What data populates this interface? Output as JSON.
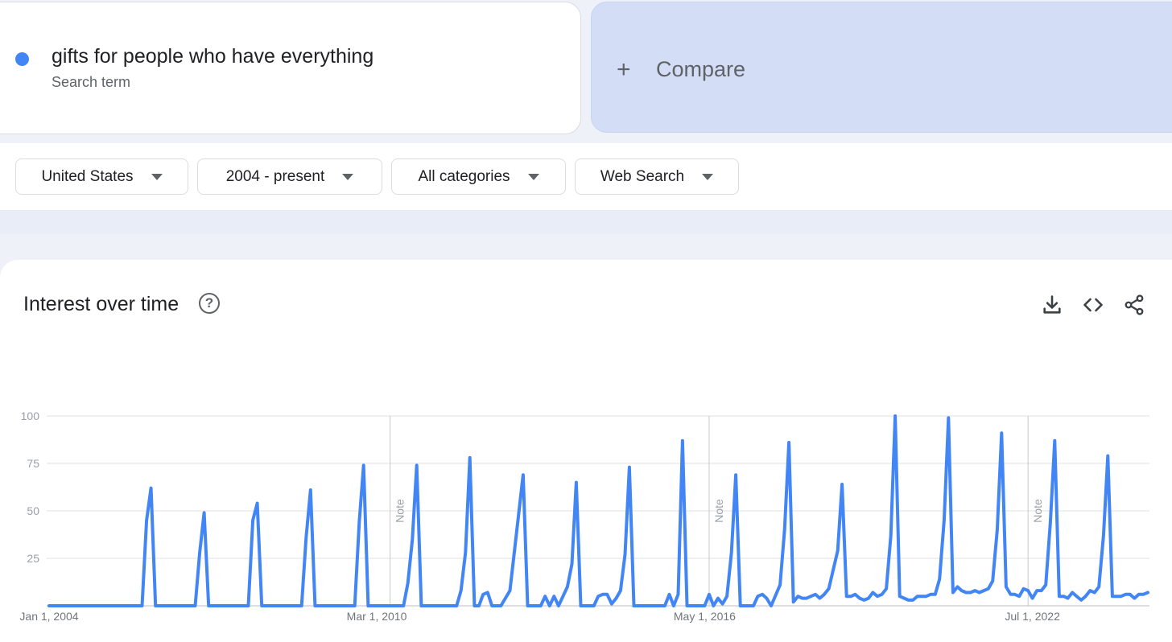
{
  "search_term": {
    "name": "gifts for people who have everything",
    "subtitle": "Search term",
    "color": "#4285f4"
  },
  "compare": {
    "label": "Compare",
    "icon": "plus-icon"
  },
  "filters": [
    {
      "label": "United States",
      "icon": "caret-down-icon"
    },
    {
      "label": "2004 - present",
      "icon": "caret-down-icon"
    },
    {
      "label": "All categories",
      "icon": "caret-down-icon"
    },
    {
      "label": "Web Search",
      "icon": "caret-down-icon"
    }
  ],
  "panel": {
    "title": "Interest over time",
    "help_icon": "question-circle-icon",
    "actions": [
      "download-icon",
      "embed-code-icon",
      "share-icon"
    ]
  },
  "chart_data": {
    "type": "line",
    "title": "",
    "xlabel": "",
    "ylabel": "",
    "ylim": [
      0,
      100
    ],
    "y_ticks": [
      "100",
      "75",
      "50",
      "25"
    ],
    "x_ticks": [
      {
        "date": "2004-01-01",
        "label": "Jan 1, 2004"
      },
      {
        "date": "2010-03-01",
        "label": "Mar 1, 2010"
      },
      {
        "date": "2016-05-01",
        "label": "May 1, 2016"
      },
      {
        "date": "2022-07-01",
        "label": "Jul 1, 2022"
      }
    ],
    "notes": [
      {
        "date": "2010-06-01",
        "label": "Note"
      },
      {
        "date": "2016-06-01",
        "label": "Note"
      },
      {
        "date": "2022-06-01",
        "label": "Note"
      }
    ],
    "grid": true,
    "series": [
      {
        "color": "#4285f4",
        "points": [
          [
            "2004-01-01",
            0
          ],
          [
            "2004-06-01",
            0
          ],
          [
            "2004-12-01",
            0
          ],
          [
            "2005-06-01",
            0
          ],
          [
            "2005-10-01",
            0
          ],
          [
            "2005-11-01",
            45
          ],
          [
            "2005-12-01",
            62
          ],
          [
            "2006-01-01",
            0
          ],
          [
            "2006-10-01",
            0
          ],
          [
            "2006-11-01",
            28
          ],
          [
            "2006-12-01",
            49
          ],
          [
            "2007-01-01",
            0
          ],
          [
            "2007-10-01",
            0
          ],
          [
            "2007-11-01",
            45
          ],
          [
            "2007-12-01",
            54
          ],
          [
            "2008-01-01",
            0
          ],
          [
            "2008-10-01",
            0
          ],
          [
            "2008-11-01",
            36
          ],
          [
            "2008-12-01",
            61
          ],
          [
            "2009-01-01",
            0
          ],
          [
            "2009-10-01",
            0
          ],
          [
            "2009-11-01",
            44
          ],
          [
            "2009-12-01",
            74
          ],
          [
            "2010-01-01",
            0
          ],
          [
            "2010-09-01",
            0
          ],
          [
            "2010-10-01",
            12
          ],
          [
            "2010-11-01",
            35
          ],
          [
            "2010-12-01",
            74
          ],
          [
            "2011-01-01",
            0
          ],
          [
            "2011-09-01",
            0
          ],
          [
            "2011-10-01",
            8
          ],
          [
            "2011-11-01",
            28
          ],
          [
            "2011-12-01",
            78
          ],
          [
            "2012-01-01",
            0
          ],
          [
            "2012-02-01",
            0
          ],
          [
            "2012-03-01",
            6
          ],
          [
            "2012-04-01",
            7
          ],
          [
            "2012-05-01",
            0
          ],
          [
            "2012-07-01",
            0
          ],
          [
            "2012-09-01",
            8
          ],
          [
            "2012-10-01",
            28
          ],
          [
            "2012-12-01",
            69
          ],
          [
            "2013-01-01",
            0
          ],
          [
            "2013-04-01",
            0
          ],
          [
            "2013-05-01",
            5
          ],
          [
            "2013-06-01",
            0
          ],
          [
            "2013-07-01",
            5
          ],
          [
            "2013-08-01",
            0
          ],
          [
            "2013-10-01",
            10
          ],
          [
            "2013-11-01",
            22
          ],
          [
            "2013-12-01",
            65
          ],
          [
            "2014-01-01",
            0
          ],
          [
            "2014-04-01",
            0
          ],
          [
            "2014-05-01",
            5
          ],
          [
            "2014-06-01",
            6
          ],
          [
            "2014-07-01",
            6
          ],
          [
            "2014-08-01",
            1
          ],
          [
            "2014-09-01",
            4
          ],
          [
            "2014-10-01",
            8
          ],
          [
            "2014-11-01",
            27
          ],
          [
            "2014-12-01",
            73
          ],
          [
            "2015-01-01",
            0
          ],
          [
            "2015-08-01",
            0
          ],
          [
            "2015-09-01",
            6
          ],
          [
            "2015-10-01",
            0
          ],
          [
            "2015-11-01",
            6
          ],
          [
            "2015-12-01",
            87
          ],
          [
            "2016-01-01",
            0
          ],
          [
            "2016-05-01",
            0
          ],
          [
            "2016-06-01",
            6
          ],
          [
            "2016-07-01",
            0
          ],
          [
            "2016-08-01",
            4
          ],
          [
            "2016-09-01",
            1
          ],
          [
            "2016-10-01",
            5
          ],
          [
            "2016-11-01",
            28
          ],
          [
            "2016-12-01",
            69
          ],
          [
            "2017-01-01",
            0
          ],
          [
            "2017-04-01",
            0
          ],
          [
            "2017-05-01",
            5
          ],
          [
            "2017-06-01",
            6
          ],
          [
            "2017-07-01",
            4
          ],
          [
            "2017-08-01",
            0
          ],
          [
            "2017-10-01",
            11
          ],
          [
            "2017-11-01",
            40
          ],
          [
            "2017-12-01",
            86
          ],
          [
            "2018-01-01",
            2
          ],
          [
            "2018-02-01",
            5
          ],
          [
            "2018-03-01",
            4
          ],
          [
            "2018-04-01",
            4
          ],
          [
            "2018-05-01",
            5
          ],
          [
            "2018-06-01",
            6
          ],
          [
            "2018-07-01",
            4
          ],
          [
            "2018-08-01",
            6
          ],
          [
            "2018-09-01",
            9
          ],
          [
            "2018-11-01",
            29
          ],
          [
            "2018-12-01",
            64
          ],
          [
            "2019-01-01",
            5
          ],
          [
            "2019-02-01",
            5
          ],
          [
            "2019-03-01",
            6
          ],
          [
            "2019-04-01",
            4
          ],
          [
            "2019-05-01",
            3
          ],
          [
            "2019-06-01",
            4
          ],
          [
            "2019-07-01",
            7
          ],
          [
            "2019-08-01",
            5
          ],
          [
            "2019-09-01",
            6
          ],
          [
            "2019-10-01",
            9
          ],
          [
            "2019-11-01",
            37
          ],
          [
            "2019-12-01",
            100
          ],
          [
            "2020-01-01",
            5
          ],
          [
            "2020-02-01",
            4
          ],
          [
            "2020-03-01",
            3
          ],
          [
            "2020-04-01",
            3
          ],
          [
            "2020-05-01",
            5
          ],
          [
            "2020-06-01",
            5
          ],
          [
            "2020-07-01",
            5
          ],
          [
            "2020-08-01",
            6
          ],
          [
            "2020-09-01",
            6
          ],
          [
            "2020-10-01",
            14
          ],
          [
            "2020-11-01",
            45
          ],
          [
            "2020-12-01",
            99
          ],
          [
            "2021-01-01",
            7
          ],
          [
            "2021-02-01",
            10
          ],
          [
            "2021-03-01",
            8
          ],
          [
            "2021-04-01",
            7
          ],
          [
            "2021-05-01",
            7
          ],
          [
            "2021-06-01",
            8
          ],
          [
            "2021-07-01",
            7
          ],
          [
            "2021-08-01",
            8
          ],
          [
            "2021-09-01",
            9
          ],
          [
            "2021-10-01",
            13
          ],
          [
            "2021-11-01",
            40
          ],
          [
            "2021-12-01",
            91
          ],
          [
            "2022-01-01",
            10
          ],
          [
            "2022-02-01",
            6
          ],
          [
            "2022-03-01",
            6
          ],
          [
            "2022-04-01",
            5
          ],
          [
            "2022-05-01",
            9
          ],
          [
            "2022-06-01",
            8
          ],
          [
            "2022-07-01",
            4
          ],
          [
            "2022-08-01",
            8
          ],
          [
            "2022-09-01",
            8
          ],
          [
            "2022-10-01",
            11
          ],
          [
            "2022-11-01",
            44
          ],
          [
            "2022-12-01",
            87
          ],
          [
            "2023-01-01",
            5
          ],
          [
            "2023-02-01",
            5
          ],
          [
            "2023-03-01",
            4
          ],
          [
            "2023-04-01",
            7
          ],
          [
            "2023-05-01",
            5
          ],
          [
            "2023-06-01",
            3
          ],
          [
            "2023-07-01",
            5
          ],
          [
            "2023-08-01",
            8
          ],
          [
            "2023-09-01",
            7
          ],
          [
            "2023-10-01",
            10
          ],
          [
            "2023-11-01",
            37
          ],
          [
            "2023-12-01",
            79
          ],
          [
            "2024-01-01",
            5
          ],
          [
            "2024-02-01",
            5
          ],
          [
            "2024-03-01",
            5
          ],
          [
            "2024-04-01",
            6
          ],
          [
            "2024-05-01",
            6
          ],
          [
            "2024-06-01",
            4
          ],
          [
            "2024-07-01",
            6
          ],
          [
            "2024-08-01",
            6
          ],
          [
            "2024-09-01",
            7
          ]
        ]
      }
    ]
  }
}
